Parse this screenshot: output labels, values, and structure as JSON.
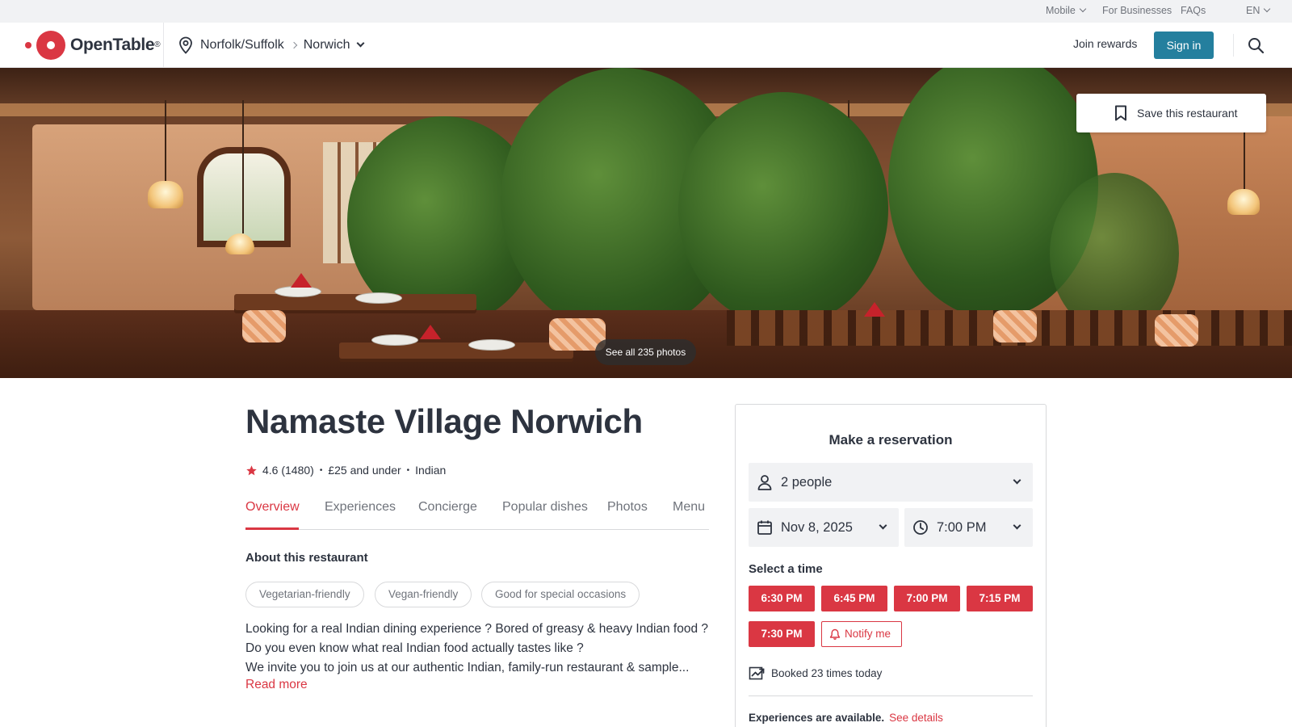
{
  "utility_bar": {
    "mobile_label": "Mobile",
    "for_businesses_label": "For Businesses",
    "faqs_label": "FAQs",
    "language_label": "EN"
  },
  "header": {
    "logo_text": "OpenTable",
    "logo_mark": "®",
    "region": "Norfolk/Suffolk",
    "city": "Norwich",
    "join_rewards_label": "Join rewards",
    "sign_in_label": "Sign in"
  },
  "hero": {
    "save_label": "Save this restaurant",
    "see_photos_label": "See all 235 photos"
  },
  "restaurant": {
    "name": "Namaste Village Norwich",
    "rating": "4.6",
    "review_count": "(1480)",
    "price": "£25 and under",
    "cuisine": "Indian",
    "separator": "•"
  },
  "tabs": [
    {
      "label": "Overview",
      "active": true
    },
    {
      "label": "Experiences",
      "active": false
    },
    {
      "label": "Concierge",
      "active": false
    },
    {
      "label": "Popular dishes",
      "active": false
    },
    {
      "label": "Photos",
      "active": false
    },
    {
      "label": "Menu",
      "active": false
    }
  ],
  "about": {
    "heading": "About this restaurant",
    "tags": [
      "Vegetarian-friendly",
      "Vegan-friendly",
      "Good for special occasions"
    ],
    "description_lines": [
      "Looking for a real Indian dining experience ? Bored of greasy & heavy Indian food ?",
      "Do you even know what real Indian food actually tastes like ?",
      "We invite you to join us at our authentic Indian, family-run restaurant & sample..."
    ],
    "read_more_label": "Read more"
  },
  "reservation": {
    "title": "Make a reservation",
    "party_size": "2 people",
    "date": "Nov 8, 2025",
    "time": "7:00 PM",
    "select_time_label": "Select a time",
    "slots": [
      "6:30 PM",
      "6:45 PM",
      "7:00 PM",
      "7:15 PM",
      "7:30 PM"
    ],
    "notify_label": "Notify me",
    "booked_text": "Booked 23 times today",
    "experiences_text": "Experiences are available.",
    "see_details_label": "See details"
  },
  "colors": {
    "brand_red": "#da3743",
    "sign_in_blue": "#247f9e",
    "text_dark": "#2d333f",
    "text_muted": "#6f737b"
  },
  "icons": {
    "location": "map-pin-icon",
    "search": "search-icon",
    "save": "bookmark-icon",
    "rating": "star-icon",
    "party": "person-icon",
    "date": "calendar-icon",
    "time": "clock-icon",
    "notify": "bell-icon",
    "booked": "trending-up-icon"
  }
}
